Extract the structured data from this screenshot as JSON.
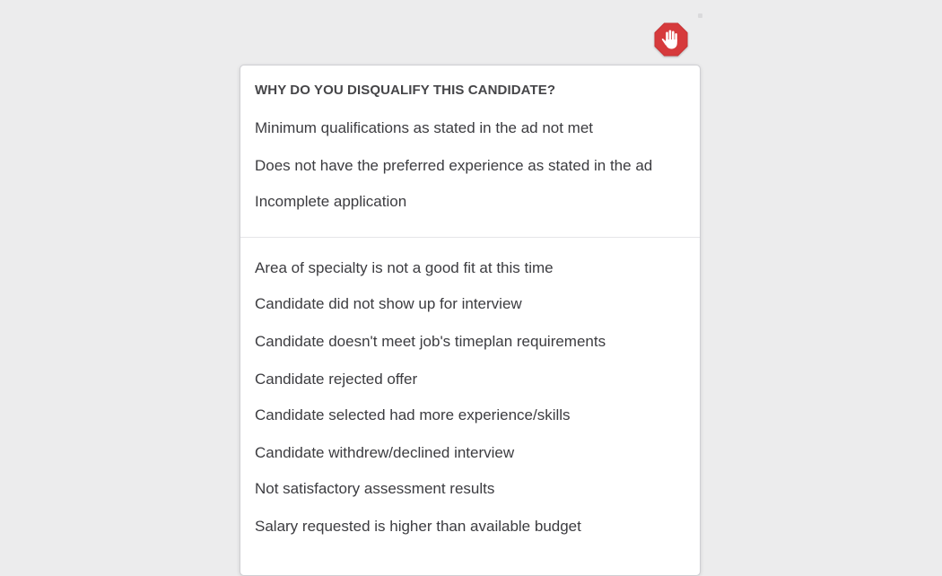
{
  "stop_button": {
    "icon": "hand-stop-icon",
    "color": "#d63a3c"
  },
  "dropdown": {
    "header": "WHY DO YOU DISQUALIFY THIS CANDIDATE?",
    "group_1": [
      "Minimum qualifications as stated in the ad not met",
      "Does not have the preferred experience as stated in the ad",
      "Incomplete application"
    ],
    "group_2": [
      "Area of specialty is not a good fit at this time",
      "Candidate did not show up for interview",
      "Candidate doesn't meet job's timeplan requirements",
      "Candidate rejected offer",
      "Candidate selected had more experience/skills",
      "Candidate withdrew/declined interview",
      "Not satisfactory assessment results",
      "Salary requested is higher than available budget"
    ]
  }
}
